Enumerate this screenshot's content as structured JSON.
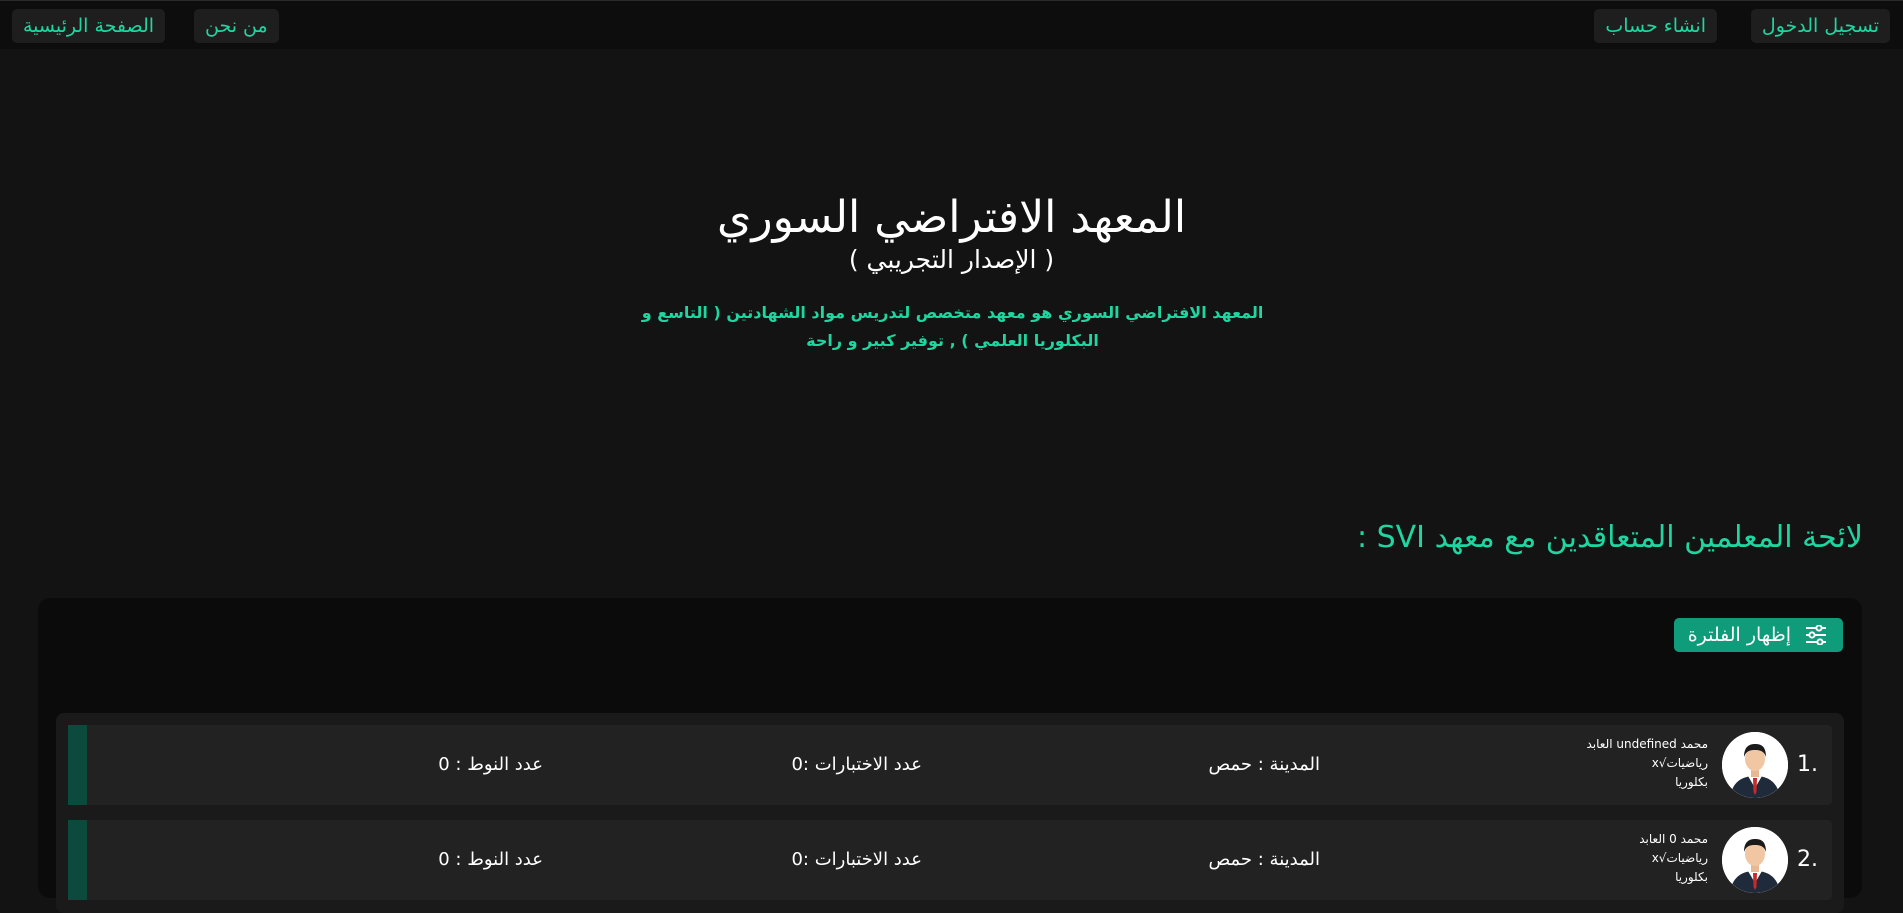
{
  "nav": {
    "home": "الصفحة الرئيسية",
    "about": "من نحن",
    "login": "تسجيل الدخول",
    "register": "انشاء حساب"
  },
  "hero": {
    "title": "المعهد الافتراضي السوري",
    "subtitle": "( الإصدار التجريبي )",
    "description": "المعهد الافتراضي السوري هو معهد متخصص لتدريس مواد الشهادتين ( التاسع و البكلوريا العلمي ) , توفير كبير و راحة"
  },
  "teachers_section": {
    "heading": "لائحة المعلمين المتعاقدين مع معهد SVI :",
    "filter_button": "إظهار الفلترة",
    "filter_icon": "sliders-icon"
  },
  "teachers": [
    {
      "index": ".1",
      "name": "محمد undefined العابد",
      "subject": "رياضيات√x",
      "level": "بكلوريا",
      "city": "المدينة : حمص",
      "exams": "عدد الاختبارات :0",
      "notes": "عدد النوط : 0"
    },
    {
      "index": ".2",
      "name": "محمد 0 العابد",
      "subject": "رياضيات√x",
      "level": "بكلوريا",
      "city": "المدينة : حمص",
      "exams": "عدد الاختبارات :0",
      "notes": "عدد النوط : 0"
    }
  ],
  "colors": {
    "accent": "#1fd6a0",
    "button": "#0f9c7a",
    "background": "#131313"
  }
}
